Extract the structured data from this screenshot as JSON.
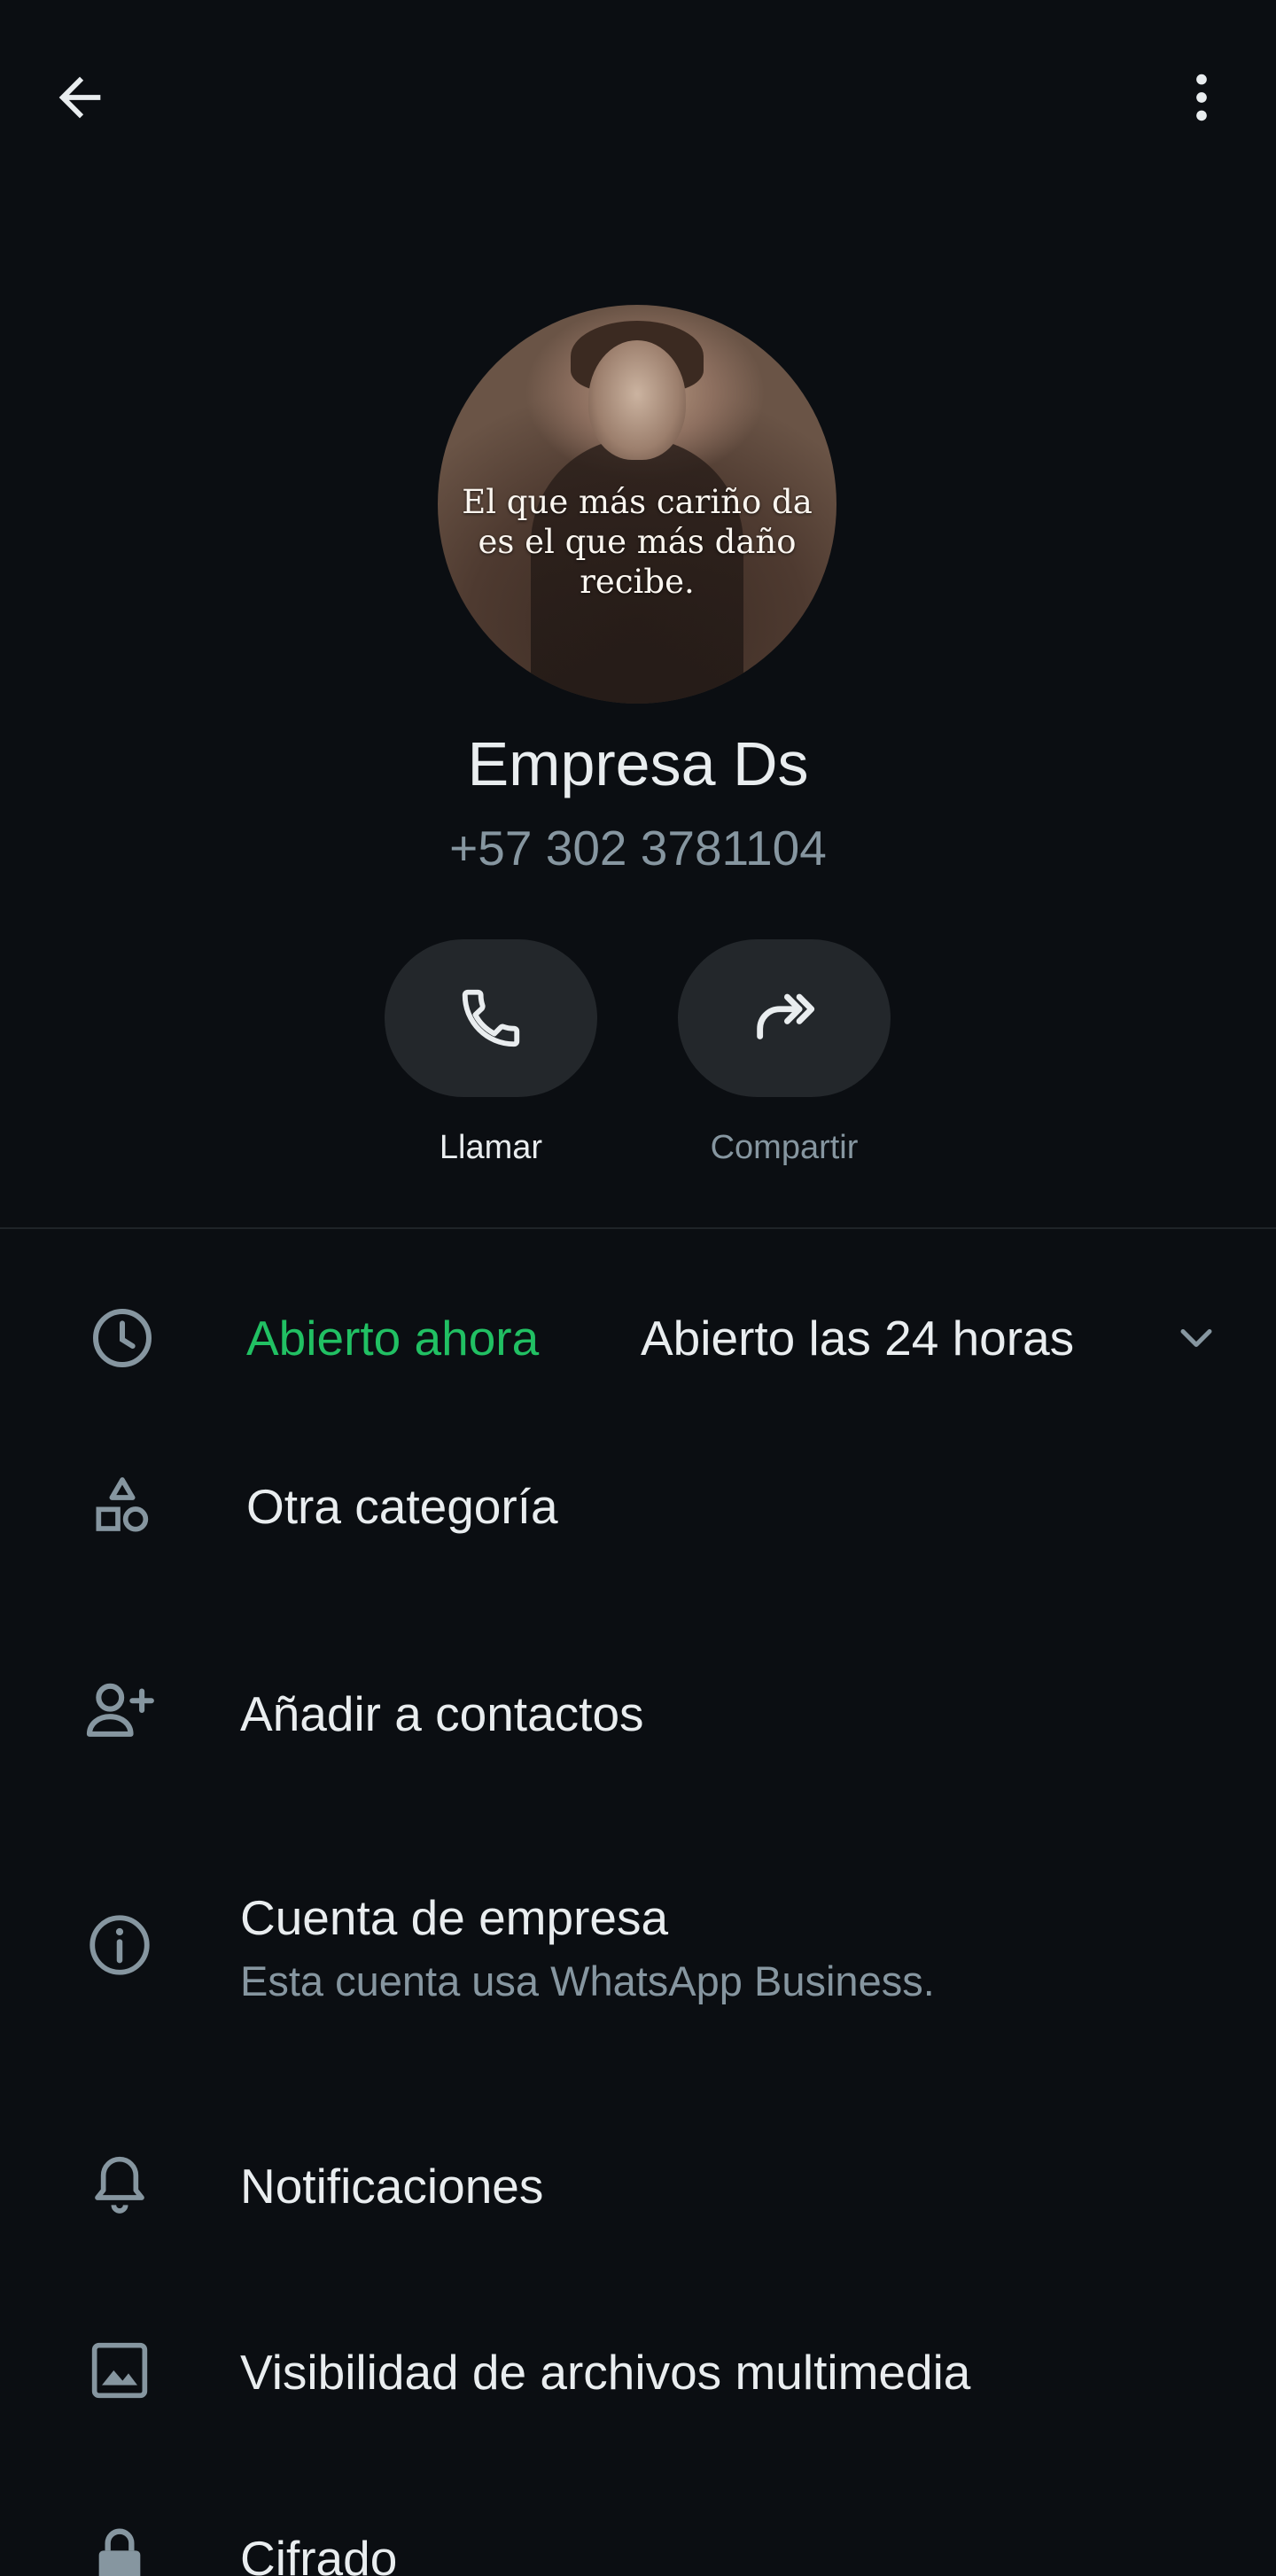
{
  "header": {
    "back_icon": "arrow-left-icon",
    "menu_icon": "more-vertical-icon"
  },
  "profile": {
    "avatar_quote": "El que más cariño da es el que más daño recibe.",
    "name": "Empresa Ds",
    "phone": "+57 302 3781104"
  },
  "actions": [
    {
      "label": "Llamar",
      "icon": "phone-icon"
    },
    {
      "label": "Compartir",
      "icon": "share-forward-icon"
    }
  ],
  "business_hours": {
    "status": "Abierto ahora",
    "hours": "Abierto las 24 horas",
    "status_color": "#21c063"
  },
  "category": "Otra categoría",
  "add_contact": "Añadir a contactos",
  "business_account": {
    "title": "Cuenta de empresa",
    "subtitle": "Esta cuenta usa WhatsApp Business."
  },
  "notifications": "Notificaciones",
  "media_visibility": "Visibilidad de archivos multimedia",
  "encryption": "Cifrado",
  "colors": {
    "background": "#0b0e12",
    "text_primary": "#e9edef",
    "text_secondary": "#8696a0",
    "accent_green": "#21c063",
    "button_bg": "#23272b"
  }
}
